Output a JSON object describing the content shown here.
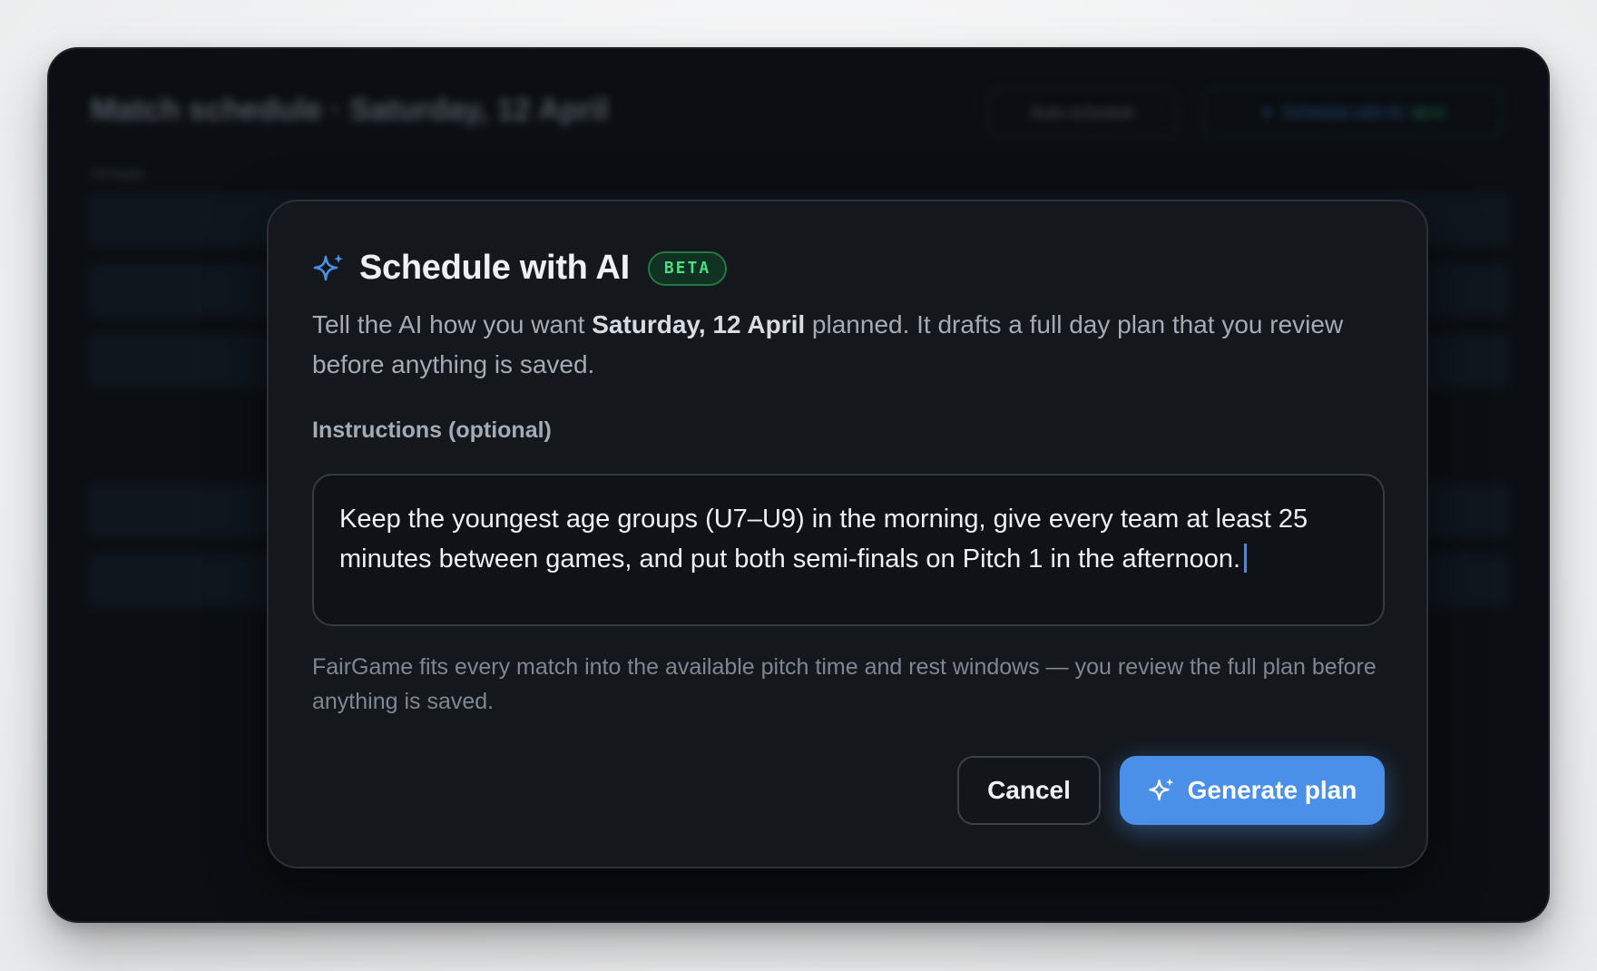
{
  "background": {
    "page_title": "Match schedule · Saturday, 12 April",
    "auto_schedule_label": "Auto-schedule",
    "ai_button_label": "Schedule with AI",
    "ai_button_badge": "BETA",
    "section_label": "All fields"
  },
  "modal": {
    "title": "Schedule with AI",
    "badge": "BETA",
    "description_before": "Tell the AI how you want ",
    "description_date": "Saturday, 12 April",
    "description_after": " planned. It drafts a full day plan that you review before anything is saved.",
    "field_label": "Instructions (optional)",
    "instructions_value": "Keep the youngest age groups (U7–U9) in the morning, give every team at least 25 minutes between games, and put both semi-finals on Pitch 1 in the afternoon.",
    "helper_text": "FairGame fits every match into the available pitch time and rest windows — you review the full plan before anything is saved.",
    "cancel_label": "Cancel",
    "generate_label": "Generate plan",
    "icon": "sparkle-icon"
  },
  "colors": {
    "accent": "#4a90e8",
    "badge_text": "#4ade80",
    "modal_bg": "#14181d",
    "app_bg": "#0b0f13"
  }
}
